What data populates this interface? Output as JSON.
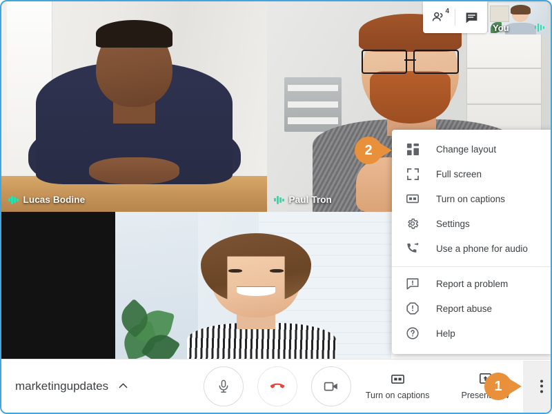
{
  "app": {
    "meeting_name": "marketingupdates"
  },
  "top_panel": {
    "participants_icon": "people-icon",
    "participants_count": "4",
    "chat_icon": "chat-icon",
    "self_view_label": "You"
  },
  "video_tiles": [
    {
      "name": "Lucas Bodine",
      "audio_indicator": "audio-wave-icon"
    },
    {
      "name": "Paul Tron",
      "audio_indicator": "audio-wave-icon"
    }
  ],
  "menu": {
    "groups": [
      {
        "items": [
          {
            "label": "Change layout",
            "icon": "layout-icon"
          },
          {
            "label": "Full screen",
            "icon": "fullscreen-icon"
          },
          {
            "label": "Turn on captions",
            "icon": "closed-caption-icon"
          },
          {
            "label": "Settings",
            "icon": "gear-icon"
          },
          {
            "label": "Use a phone for audio",
            "icon": "phone-forward-icon"
          }
        ]
      },
      {
        "items": [
          {
            "label": "Report a problem",
            "icon": "report-problem-icon"
          },
          {
            "label": "Report abuse",
            "icon": "report-abuse-icon"
          },
          {
            "label": "Help",
            "icon": "help-icon"
          }
        ]
      }
    ]
  },
  "bottom_bar": {
    "meeting_name": "marketingupdates",
    "expand_icon": "chevron-up-icon",
    "controls": [
      {
        "name": "microphone",
        "icon": "microphone-icon"
      },
      {
        "name": "hang-up",
        "icon": "phone-hangup-icon"
      },
      {
        "name": "camera",
        "icon": "video-camera-icon"
      }
    ],
    "actions": [
      {
        "label": "Turn on captions",
        "icon": "closed-caption-icon"
      },
      {
        "label": "Present now",
        "icon": "present-screen-icon"
      }
    ],
    "more_options_icon": "more-vertical-icon"
  },
  "callouts": [
    {
      "number": "1"
    },
    {
      "number": "2"
    }
  ],
  "colors": {
    "accent": "#e8903a",
    "hangup_red": "#e8453c",
    "audio_green": "#26e0b0",
    "frame_blue": "#3fa6e0"
  }
}
